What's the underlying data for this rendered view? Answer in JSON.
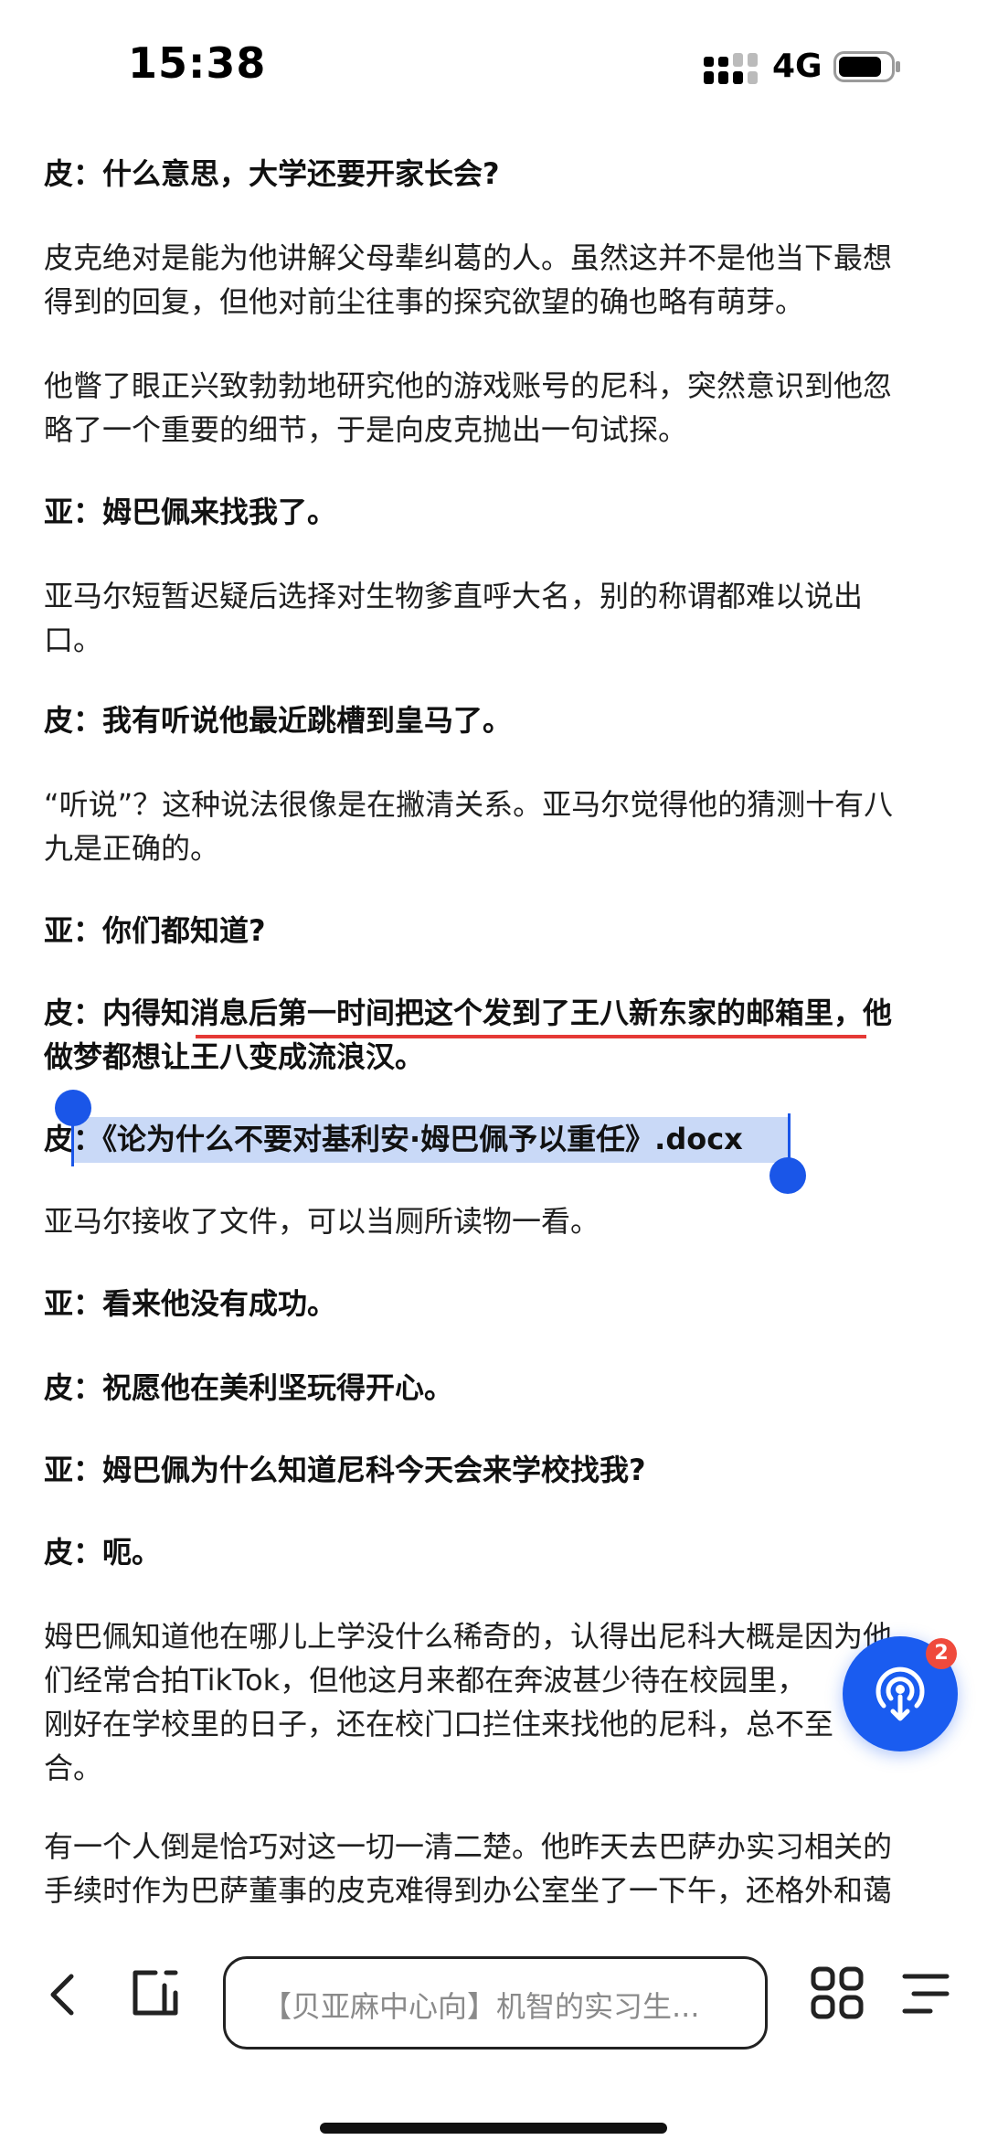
{
  "status": {
    "time": "15:38",
    "network": "4G"
  },
  "article": {
    "paragraphs": [
      {
        "bold": true,
        "lines": [
          "皮：什么意思，大学还要开家长会?"
        ]
      },
      {
        "bold": false,
        "lines": [
          "皮克绝对是能为他讲解父母辈纠葛的人。虽然这并不是他当下最想",
          "得到的回复，但他对前尘往事的探究欲望的确也略有萌芽。"
        ]
      },
      {
        "bold": false,
        "lines": [
          "他瞥了眼正兴致勃勃地研究他的游戏账号的尼科，突然意识到他忽",
          "略了一个重要的细节，于是向皮克抛出一句试探。"
        ]
      },
      {
        "bold": true,
        "lines": [
          "亚：姆巴佩来找我了。"
        ]
      },
      {
        "bold": false,
        "lines": [
          "亚马尔短暂迟疑后选择对生物爹直呼大名，别的称谓都难以说出",
          "口。"
        ]
      },
      {
        "bold": true,
        "lines": [
          "皮：我有听说他最近跳槽到皇马了。"
        ]
      },
      {
        "bold": false,
        "lines": [
          "“听说”？这种说法很像是在撇清关系。亚马尔觉得他的猜测十有八",
          "九是正确的。"
        ]
      },
      {
        "bold": true,
        "lines": [
          "亚：你们都知道?"
        ]
      },
      {
        "bold": true,
        "lines": [
          "皮：内得知消息后第一时间把这个发到了王八新东家的邮箱里，他",
          "做梦都想让王八变成流浪汉。"
        ],
        "underlined_part": "消息后第一时间把这个发到了王八新东家的邮箱里"
      },
      {
        "bold": true,
        "lines": [
          "皮：《论为什么不要对基利安·姆巴佩予以重任》.docx"
        ]
      },
      {
        "bold": false,
        "lines": [
          "亚马尔接收了文件，可以当厕所读物一看。"
        ]
      },
      {
        "bold": true,
        "lines": [
          "亚：看来他没有成功。"
        ]
      },
      {
        "bold": true,
        "lines": [
          "皮：祝愿他在美利坚玩得开心。"
        ]
      },
      {
        "bold": true,
        "lines": [
          "亚：姆巴佩为什么知道尼科今天会来学校找我?"
        ]
      },
      {
        "bold": true,
        "lines": [
          "皮：呃。"
        ]
      },
      {
        "bold": false,
        "lines": [
          "姆巴佩知道他在哪儿上学没什么稀奇的，认得出尼科大概是因为他",
          "们经常合拍TikTok，但他这月来都在奔波甚少待在校园里，",
          "刚好在学校里的日子，还在校门口拦住来找他的尼科，总不至",
          "合。"
        ]
      },
      {
        "bold": false,
        "lines": [
          "有一个人倒是恰巧对这一切一清二楚。他昨天去巴萨办实习相关的",
          "手续时作为巴萨董事的皮克难得到办公室坐了一下午，还格外和蔼"
        ]
      }
    ]
  },
  "fab": {
    "badge": "2",
    "icon": "podcast-icon"
  },
  "toolbar": {
    "address_text": "【贝亚麻中心向】机智的实习生..."
  },
  "colors": {
    "accent": "#1a5cf0",
    "selection": "#c9d9f7",
    "underline": "#e53935",
    "badge": "#ef4a3c"
  }
}
